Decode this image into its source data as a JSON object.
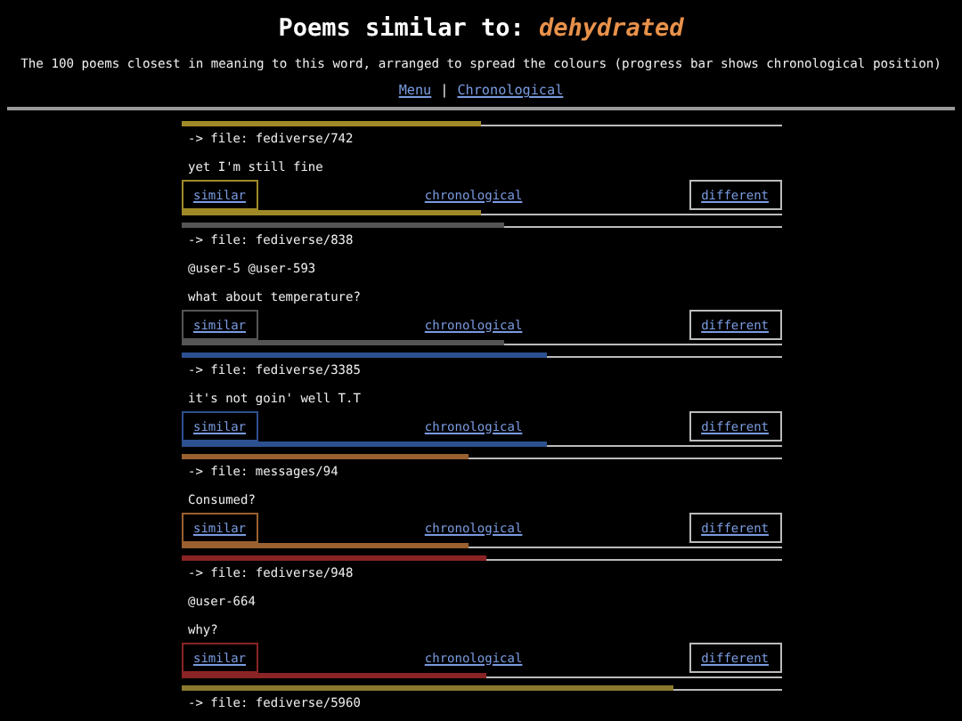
{
  "header": {
    "title": "Poems similar to:",
    "word": "dehydrated",
    "subtitle": "The 100 poems closest in meaning to this word, arranged to spread the colours (progress bar shows chronological position)",
    "links": [
      "Menu",
      "Chronological"
    ],
    "separator": "|"
  },
  "poems": [
    {
      "file": "-> file: fediverse/742",
      "lines": [
        "yet I'm still fine"
      ],
      "color": "#a08a28",
      "level": 0.5,
      "buttons": {
        "similar": "similar",
        "chronological": "chronological",
        "different": "different"
      }
    },
    {
      "file": "-> file: fediverse/838",
      "lines": [
        "@user-5 @user-593",
        "what about temperature?"
      ],
      "color": "#555555",
      "level": 0.54,
      "buttons": {
        "similar": "similar",
        "chronological": "chronological",
        "different": "different"
      }
    },
    {
      "file": "-> file: fediverse/3385",
      "lines": [
        "it's not goin' well T.T"
      ],
      "color": "#2d5090",
      "level": 0.61,
      "buttons": {
        "similar": "similar",
        "chronological": "chronological",
        "different": "different"
      }
    },
    {
      "file": "-> file: messages/94",
      "lines": [
        "Consumed?"
      ],
      "color": "#9a6030",
      "level": 0.48,
      "buttons": {
        "similar": "similar",
        "chronological": "chronological",
        "different": "different"
      }
    },
    {
      "file": "-> file: fediverse/948",
      "lines": [
        "@user-664",
        "why?"
      ],
      "color": "#8a2424",
      "level": 0.51,
      "buttons": {
        "similar": "similar",
        "chronological": "chronological",
        "different": "different"
      }
    },
    {
      "file": "-> file: fediverse/5960",
      "color": "#8a7a30",
      "level": 0.82
    }
  ]
}
